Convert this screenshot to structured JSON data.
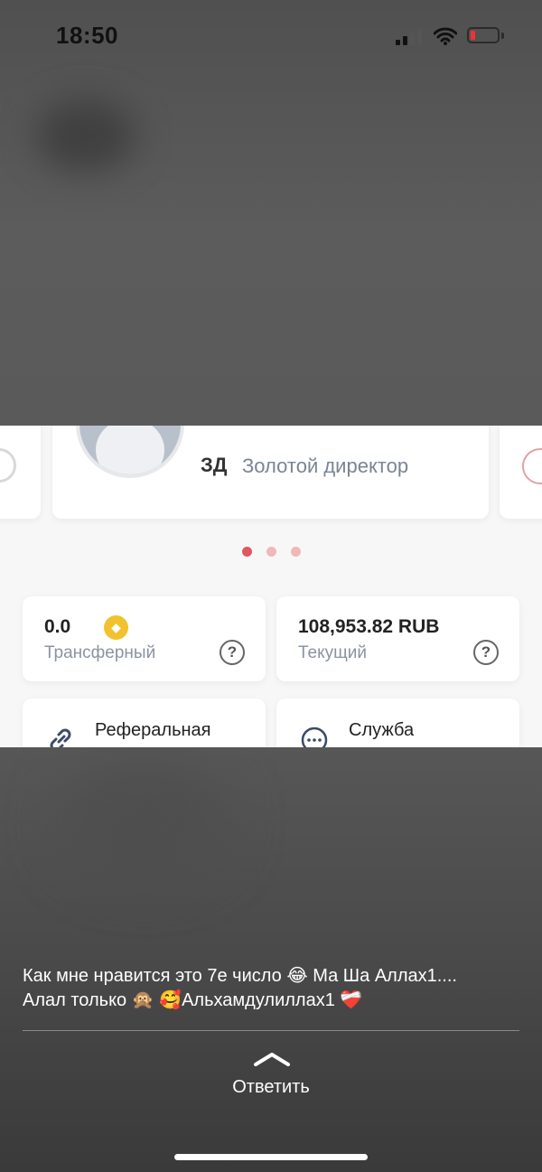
{
  "status_bar": {
    "time": "18:50"
  },
  "rank": {
    "code": "ЗД",
    "name": "Золотой директор"
  },
  "carousel": {
    "active_index": 0,
    "count": 3
  },
  "balances": [
    {
      "value": "0.0",
      "label": "Трансферный",
      "has_gem": true
    },
    {
      "value": "108,953.82 RUB",
      "label": "Текущий",
      "has_gem": false
    }
  ],
  "menu": [
    {
      "label": "Реферальная",
      "icon": "link-icon"
    },
    {
      "label": "Служба",
      "icon": "chat-icon"
    }
  ],
  "message": {
    "line1": "Как мне нравится это 7е число 😂 Ма Ша Аллах1....",
    "line2": "Алал только 🙊 🥰Альхамдулиллах1 ❤️‍🩹"
  },
  "reply": {
    "label": "Ответить"
  },
  "colors": {
    "dot_active": "#e0585c",
    "dot_inactive": "#f0b8b8",
    "gem": "#f2c12e"
  }
}
